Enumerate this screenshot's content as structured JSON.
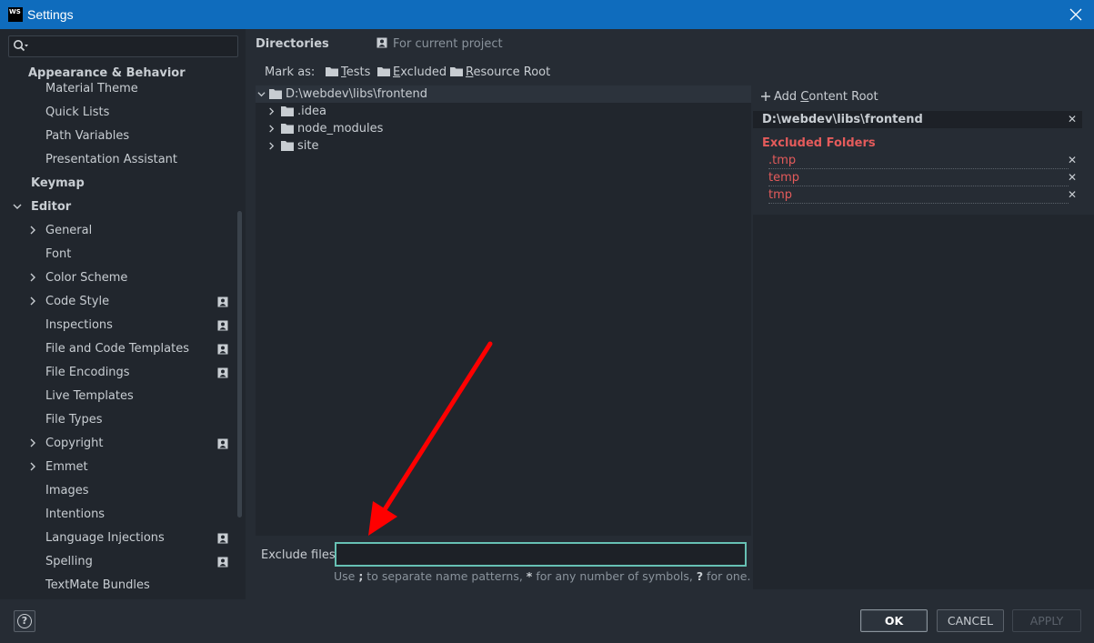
{
  "window": {
    "title": "Settings",
    "app_icon_text": "WS"
  },
  "sidebar": {
    "search": {
      "placeholder": "",
      "value": ""
    },
    "items": [
      {
        "label": "Appearance & Behavior",
        "bold": true
      },
      {
        "label": "Material Theme"
      },
      {
        "label": "Quick Lists"
      },
      {
        "label": "Path Variables"
      },
      {
        "label": "Presentation Assistant"
      },
      {
        "label": "Keymap",
        "bold": true
      },
      {
        "label": "Editor",
        "bold": true,
        "expanded": true
      },
      {
        "label": "General",
        "collapsed": true
      },
      {
        "label": "Font"
      },
      {
        "label": "Color Scheme",
        "collapsed": true
      },
      {
        "label": "Code Style",
        "collapsed": true,
        "project": true
      },
      {
        "label": "Inspections",
        "project": true
      },
      {
        "label": "File and Code Templates",
        "project": true
      },
      {
        "label": "File Encodings",
        "project": true
      },
      {
        "label": "Live Templates"
      },
      {
        "label": "File Types"
      },
      {
        "label": "Copyright",
        "collapsed": true,
        "project": true
      },
      {
        "label": "Emmet",
        "collapsed": true
      },
      {
        "label": "Images"
      },
      {
        "label": "Intentions"
      },
      {
        "label": "Language Injections",
        "project": true
      },
      {
        "label": "Spelling",
        "project": true
      },
      {
        "label": "TextMate Bundles"
      }
    ]
  },
  "main": {
    "title": "Directories",
    "scope": "For current project",
    "mark_as_label": "Mark as:",
    "mark_buttons": [
      {
        "label": "Tests",
        "mnemonic": "T",
        "rest": "ests"
      },
      {
        "label": "Excluded",
        "mnemonic": "E",
        "rest": "xcluded"
      },
      {
        "label": "Resource Root",
        "mnemonic": "R",
        "rest": "esource Root"
      }
    ],
    "tree": {
      "root": "D:\\webdev\\libs\\frontend",
      "children": [
        ".idea",
        "node_modules",
        "site"
      ]
    },
    "exclude_files": {
      "label": "Exclude files:",
      "value": "",
      "hint_parts": [
        "Use ",
        ";",
        " to separate name patterns, ",
        "*",
        " for any number of symbols, ",
        "?",
        " for one."
      ]
    }
  },
  "content_roots": {
    "add_label": "Add Content Root",
    "add_mnemonic": "C",
    "add_pre": "Add ",
    "add_rest": "ontent Root",
    "root_path": "D:\\webdev\\libs\\frontend",
    "excluded_title": "Excluded Folders",
    "excluded": [
      ".tmp",
      "temp",
      "tmp"
    ],
    "remove_glyph": "✕"
  },
  "footer": {
    "help_glyph": "?",
    "ok": "OK",
    "cancel": "CANCEL",
    "apply": "APPLY"
  },
  "colors": {
    "accent_input_border": "#67c1b4",
    "excluded_red": "#e45b5b",
    "annotation_arrow": "#ff0000",
    "titlebar": "#0f6cbd"
  }
}
